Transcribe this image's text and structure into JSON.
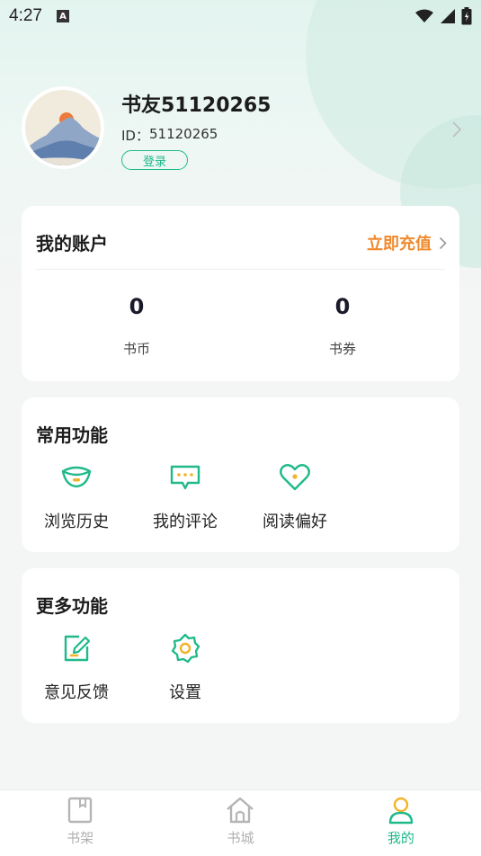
{
  "status_bar": {
    "time": "4:27",
    "notification_letter": "A"
  },
  "profile": {
    "username": "书友51120265",
    "id_label": "ID：",
    "id_value": "51120265",
    "login_label": "登录"
  },
  "account": {
    "title": "我的账户",
    "recharge_label": "立即充值",
    "stats": [
      {
        "value": "0",
        "label": "书币"
      },
      {
        "value": "0",
        "label": "书券"
      }
    ]
  },
  "common_functions": {
    "title": "常用功能",
    "items": [
      {
        "label": "浏览历史",
        "icon": "eye-icon"
      },
      {
        "label": "我的评论",
        "icon": "comment-icon"
      },
      {
        "label": "阅读偏好",
        "icon": "heart-icon"
      }
    ]
  },
  "more_functions": {
    "title": "更多功能",
    "items": [
      {
        "label": "意见反馈",
        "icon": "feedback-edit-icon"
      },
      {
        "label": "设置",
        "icon": "gear-icon"
      }
    ]
  },
  "tabbar": {
    "items": [
      {
        "label": "书架",
        "icon": "bookshelf-icon",
        "active": false
      },
      {
        "label": "书城",
        "icon": "home-icon",
        "active": false
      },
      {
        "label": "我的",
        "icon": "person-icon",
        "active": true
      }
    ]
  },
  "colors": {
    "accent": "#1fb98a",
    "recharge": "#f08a2e",
    "inactive_tab": "#b0b0b0"
  }
}
